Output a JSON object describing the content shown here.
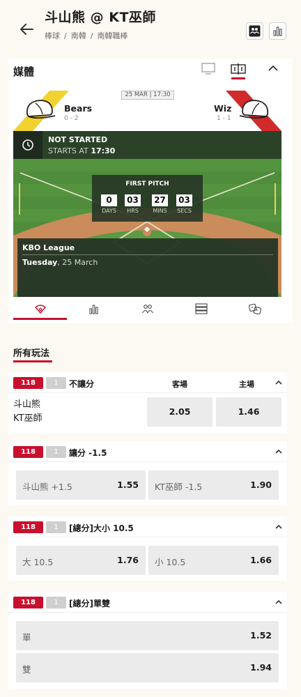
{
  "header": {
    "title": "斗山熊 @ KT巫師",
    "breadcrumb": [
      "棒球",
      "南韓",
      "南韓職棒"
    ],
    "breadcrumb_sep": "/"
  },
  "media": {
    "title": "媒體",
    "date": "25 MAR | 17:30",
    "home_team": {
      "name": "Bears",
      "record": "0 - 2",
      "stripe_color": "#f2d230"
    },
    "away_team": {
      "name": "Wiz",
      "record": "1 - 1",
      "stripe_color": "#d22a2a"
    },
    "status": {
      "state": "NOT STARTED",
      "starts_prefix": "STARTS AT",
      "starts_time": "17:30"
    },
    "countdown": {
      "heading": "FIRST PITCH",
      "units": [
        {
          "value": "0",
          "label": "DAYS"
        },
        {
          "value": "03",
          "label": "HRS"
        },
        {
          "value": "27",
          "label": "MINS"
        },
        {
          "value": "03",
          "label": "SECS"
        }
      ]
    },
    "league": {
      "name": "KBO League",
      "day": "Tuesday",
      "date": ", 25 March"
    },
    "tabs": [
      "field-tab",
      "stats-tab",
      "lineups-tab",
      "list-tab",
      "h2h-tab"
    ],
    "active_tab": 0
  },
  "markets_title": "所有玩法",
  "markets": [
    {
      "id": "118",
      "count": "1",
      "name": "不讓分",
      "col_away": "客場",
      "col_home": "主場",
      "team_a": "斗山熊",
      "team_b": "KT巫師",
      "odds": [
        "2.05",
        "1.46"
      ]
    },
    {
      "id": "118",
      "count": "1",
      "name": "讓分 -1.5",
      "options": [
        {
          "label": "斗山熊 +1.5",
          "odd": "1.55"
        },
        {
          "label": "KT巫師 -1.5",
          "odd": "1.90"
        }
      ]
    },
    {
      "id": "118",
      "count": "1",
      "name": "[總分]大小 10.5",
      "options": [
        {
          "label": "大 10.5",
          "odd": "1.76"
        },
        {
          "label": "小 10.5",
          "odd": "1.66"
        }
      ]
    },
    {
      "id": "118",
      "count": "1",
      "name": "[總分]單雙",
      "options": [
        {
          "label": "單",
          "odd": "1.52"
        },
        {
          "label": "雙",
          "odd": "1.94"
        }
      ]
    }
  ],
  "colors": {
    "accent": "#c8102e",
    "pitch": "#4d8a3a",
    "background": "#fbf9f1"
  }
}
